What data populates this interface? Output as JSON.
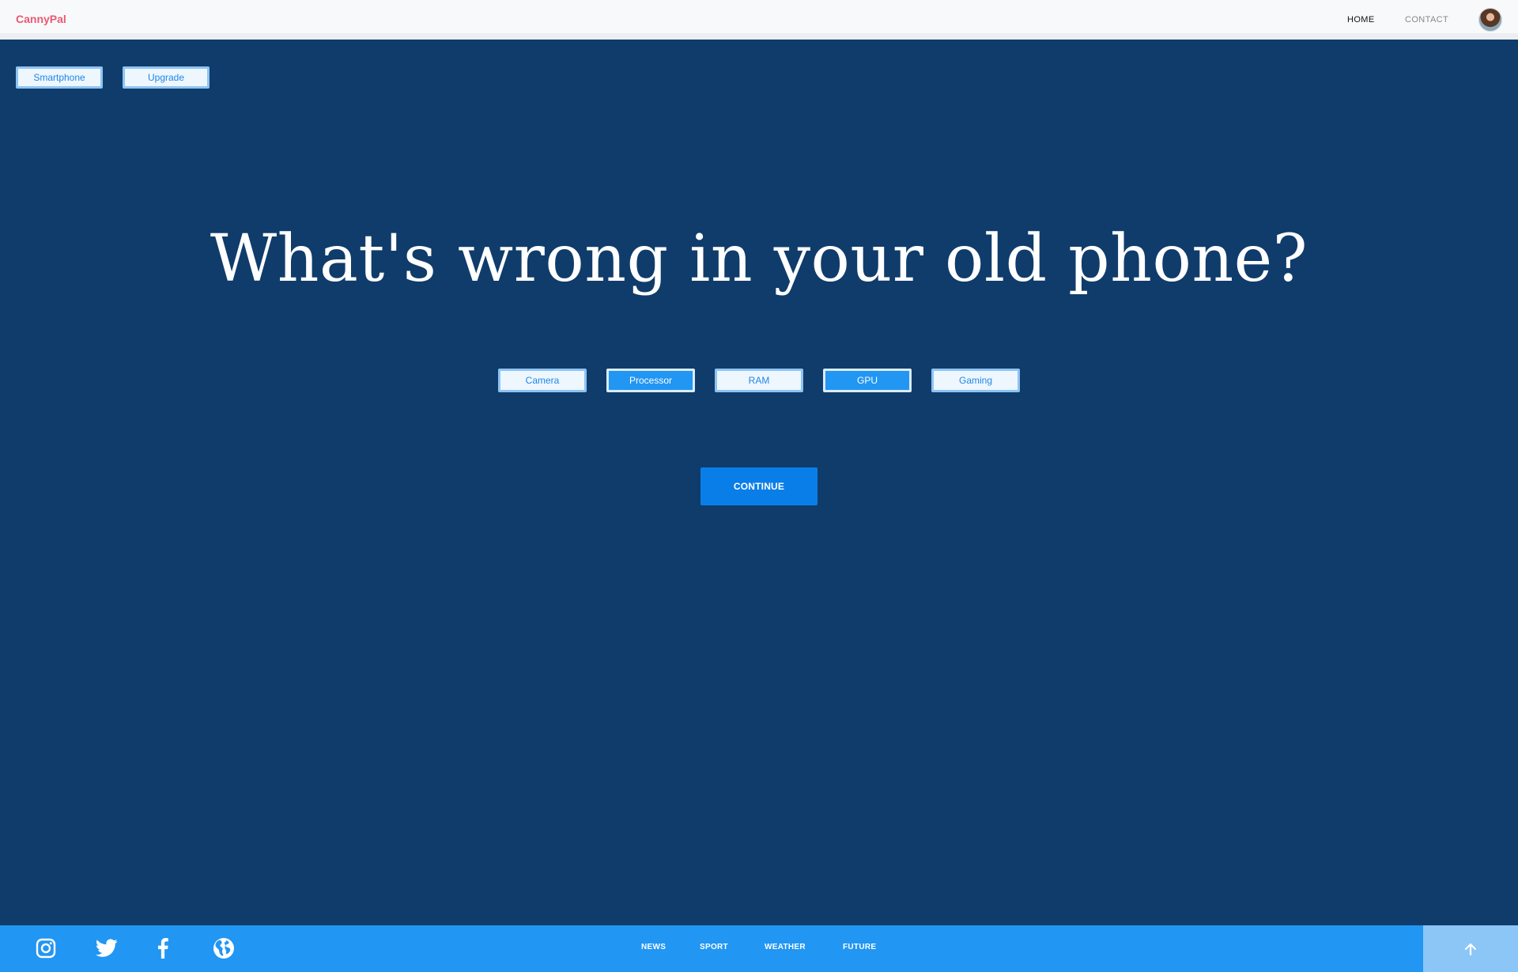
{
  "header": {
    "brand": "CannyPal",
    "nav": [
      {
        "label": "HOME",
        "active": true
      },
      {
        "label": "CONTACT",
        "active": false
      }
    ]
  },
  "tags": [
    "Smartphone",
    "Upgrade"
  ],
  "main": {
    "headline": "What's wrong in your old phone?",
    "options": [
      {
        "label": "Camera",
        "selected": false
      },
      {
        "label": "Processor",
        "selected": true
      },
      {
        "label": "RAM",
        "selected": false
      },
      {
        "label": "GPU",
        "selected": true
      },
      {
        "label": "Gaming",
        "selected": false
      }
    ],
    "continue_label": "CONTINUE"
  },
  "footer": {
    "social_icons": [
      "instagram-icon",
      "twitter-icon",
      "facebook-icon",
      "globe-icon"
    ],
    "links": [
      "NEWS",
      "SPORT",
      "WEATHER",
      "FUTURE"
    ],
    "to_top_icon": "arrow-up-icon"
  },
  "colors": {
    "background": "#0f3c6b",
    "accent": "#2196f3",
    "brand": "#e85a72",
    "footer": "#2196f3"
  }
}
